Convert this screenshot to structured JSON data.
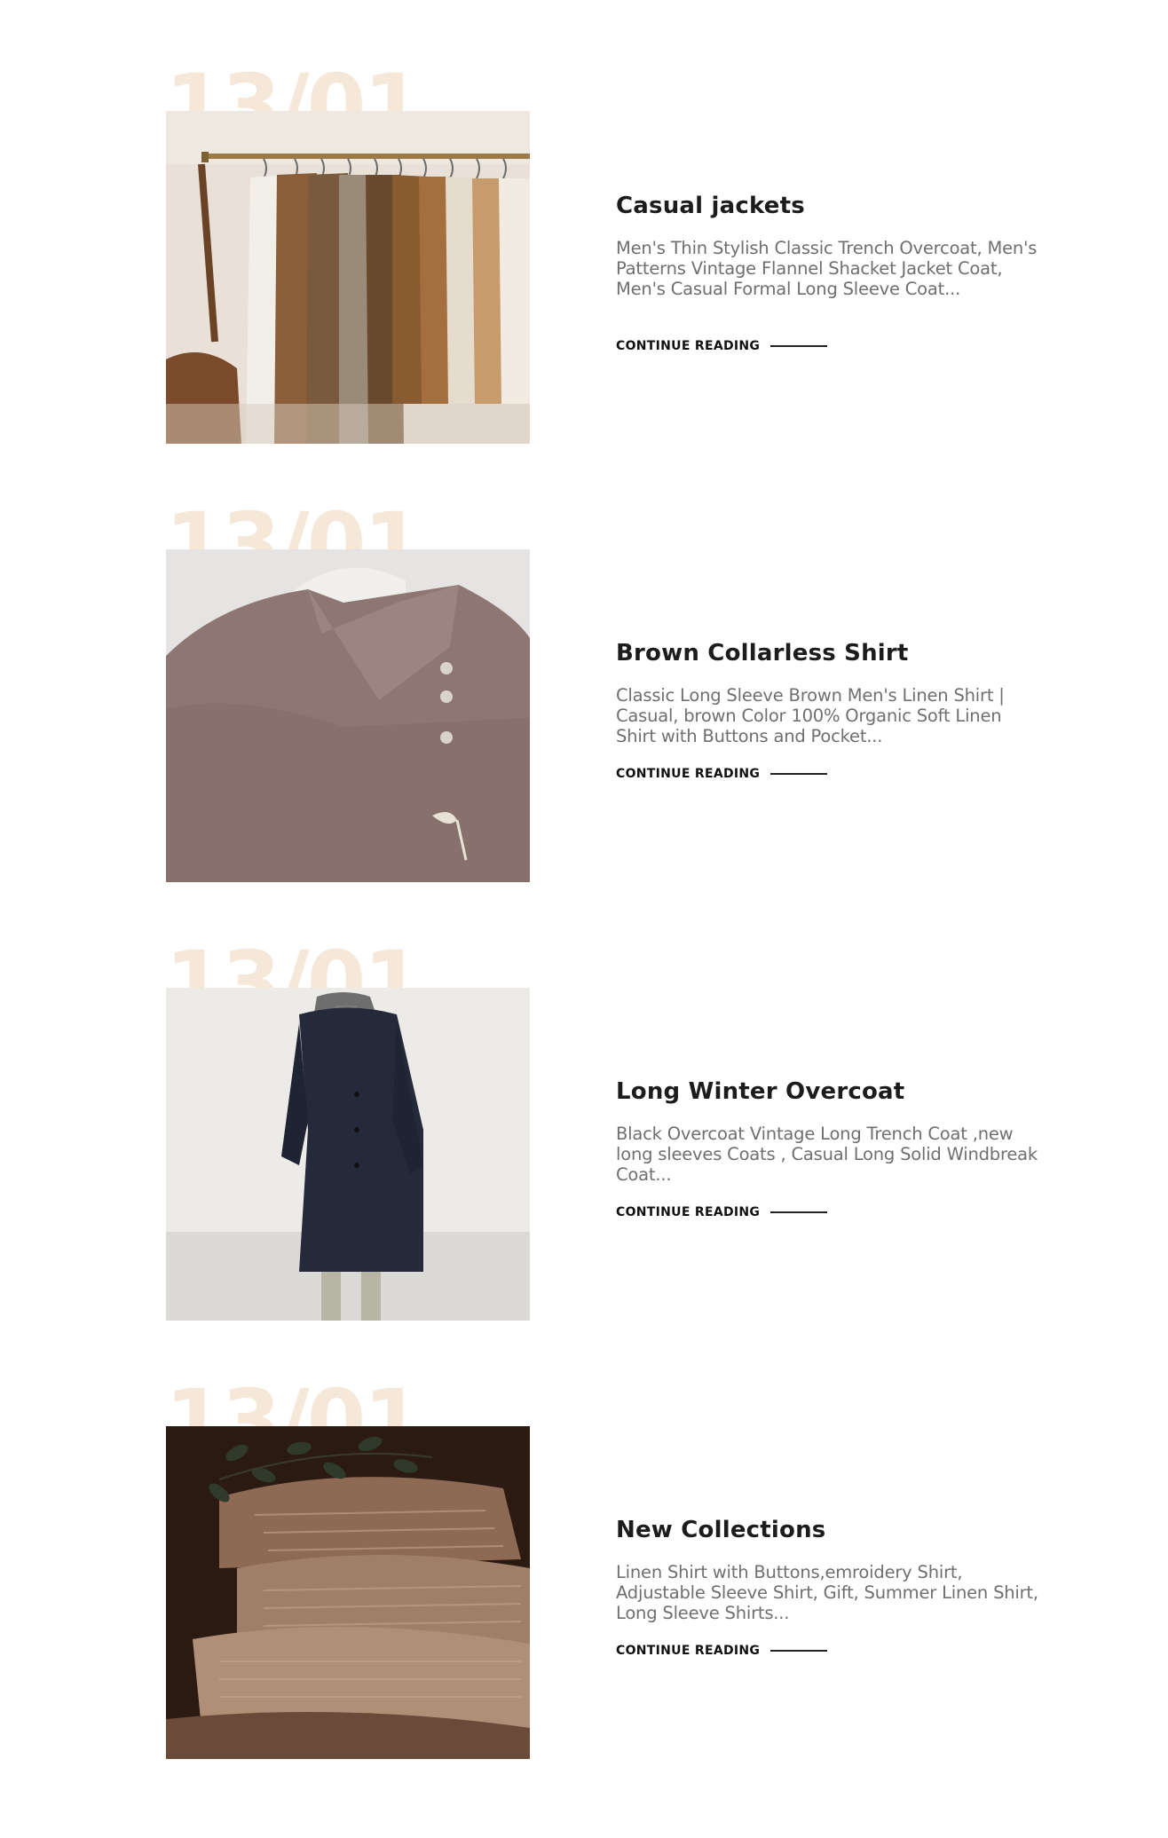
{
  "posts": [
    {
      "date": "13/01",
      "title": "Casual jackets",
      "excerpt": "Men's Thin Stylish Classic Trench Overcoat, Men's Patterns Vintage Flannel Shacket Jacket Coat, Men's Casual Formal Long Sleeve Coat...",
      "link_label": "CONTINUE READING"
    },
    {
      "date": "13/01",
      "title": "Brown Collarless Shirt",
      "excerpt": "Classic Long Sleeve Brown Men's Linen Shirt | Casual, brown Color 100% Organic Soft Linen Shirt with Buttons and Pocket...",
      "link_label": "CONTINUE READING"
    },
    {
      "date": "13/01",
      "title": "Long Winter Overcoat",
      "excerpt": "Black Overcoat Vintage Long Trench Coat ,new long sleeves Coats , Casual Long Solid Windbreak Coat...",
      "link_label": "CONTINUE READING"
    },
    {
      "date": "13/01",
      "title": "New Collections",
      "excerpt": "Linen Shirt with Buttons,emroidery Shirt, Adjustable Sleeve Shirt, Gift, Summer Linen Shirt, Long Sleeve Shirts...",
      "link_label": "CONTINUE READING"
    }
  ],
  "colors": {
    "date_watermark": "#f6e8d8",
    "title": "#1c1c1c",
    "excerpt": "#6f6f6f"
  },
  "images": [
    "clothing-rack-photo",
    "linen-shirt-photo",
    "overcoat-photo",
    "knit-sweaters-photo"
  ]
}
